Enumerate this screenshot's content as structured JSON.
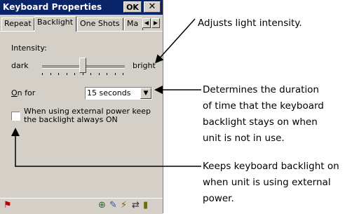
{
  "window": {
    "title": "Keyboard Properties",
    "ok_label": "OK",
    "close_label": "✕"
  },
  "tabs": [
    {
      "label": "Repeat"
    },
    {
      "label": "Backlight"
    },
    {
      "label": "One Shots"
    },
    {
      "label": "Ma"
    }
  ],
  "active_tab": "Backlight",
  "intensity": {
    "label": "Intensity:",
    "min_label": "dark",
    "max_label": "bright",
    "level_fraction": 0.5
  },
  "on_for": {
    "label": "On for",
    "selected": "15 seconds"
  },
  "external_power": {
    "label": "When using external power keep the backlight always ON",
    "checked": false
  },
  "annotations": {
    "intensity": "Adjusts light intensity.",
    "duration": [
      "Determines the duration",
      "of time that the keyboard",
      "backlight stays on when",
      "unit is not in use."
    ],
    "external": [
      "Keeps keyboard backlight on",
      "when unit is using external",
      "power."
    ]
  },
  "icons": {
    "start": "start-flag-icon",
    "tray": [
      "network-icon",
      "input-icon",
      "power-icon",
      "sync-icon",
      "battery-icon"
    ]
  }
}
